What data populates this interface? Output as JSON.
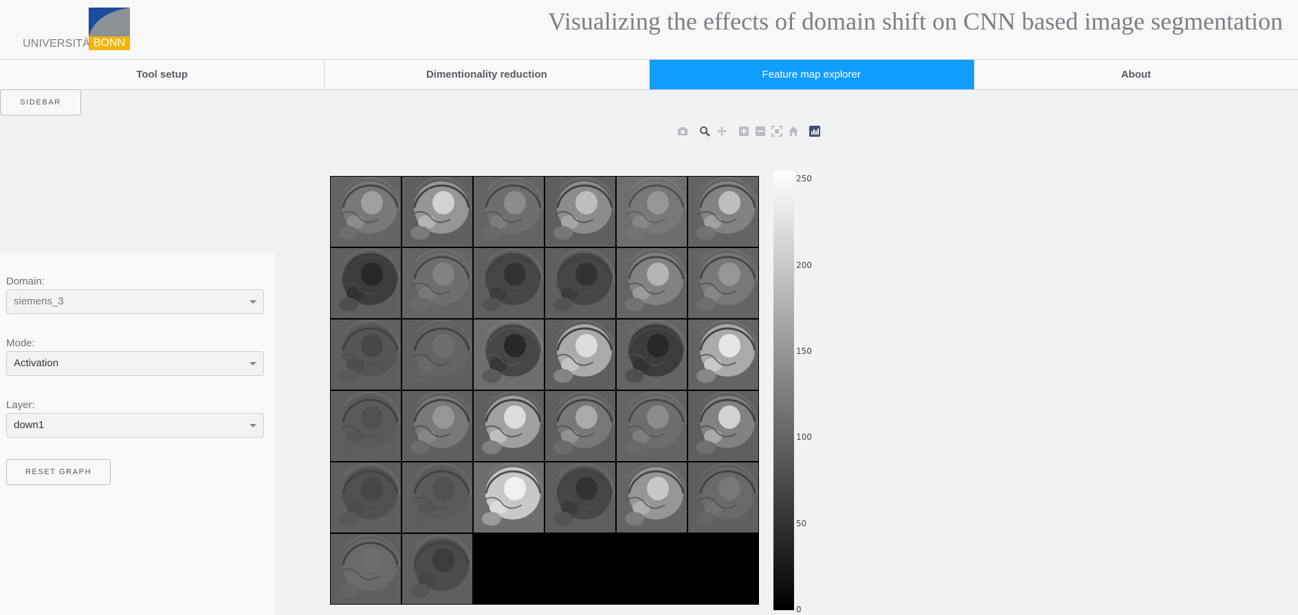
{
  "header": {
    "logo": {
      "university": "UNIVERSITÄT",
      "city": "BONN"
    },
    "title": "Visualizing the effects of domain shift on CNN based image segmentation"
  },
  "tabs": [
    {
      "label": "Tool setup",
      "active": false
    },
    {
      "label": "Dimentionality reduction",
      "active": false
    },
    {
      "label": "Feature map explorer",
      "active": true
    },
    {
      "label": "About",
      "active": false
    }
  ],
  "sidebar_toggle": {
    "label": "SIDEBAR"
  },
  "controls": {
    "domain": {
      "label": "Domain:",
      "value": "siemens_3",
      "disabled": true
    },
    "mode": {
      "label": "Mode:",
      "value": "Activation"
    },
    "layer": {
      "label": "Layer:",
      "value": "down1"
    },
    "reset": {
      "label": "RESET GRAPH"
    }
  },
  "modebar": {
    "icons": [
      "camera-icon",
      "zoom-icon",
      "pan-icon",
      "zoom-in-icon",
      "zoom-out-icon",
      "autoscale-icon",
      "home-icon",
      "plotly-logo-icon"
    ]
  },
  "feature_maps": {
    "grid": {
      "rows": 6,
      "cols": 6
    },
    "tiles": [
      {
        "mean": 100,
        "brain": 120,
        "bright": 160
      },
      {
        "mean": 95,
        "brain": 150,
        "bright": 210
      },
      {
        "mean": 100,
        "brain": 110,
        "bright": 140
      },
      {
        "mean": 95,
        "brain": 140,
        "bright": 190
      },
      {
        "mean": 110,
        "brain": 120,
        "bright": 150
      },
      {
        "mean": 100,
        "brain": 130,
        "bright": 190
      },
      {
        "mean": 95,
        "brain": 60,
        "bright": 40
      },
      {
        "mean": 100,
        "brain": 110,
        "bright": 130
      },
      {
        "mean": 95,
        "brain": 70,
        "bright": 50
      },
      {
        "mean": 95,
        "brain": 70,
        "bright": 50
      },
      {
        "mean": 100,
        "brain": 130,
        "bright": 180
      },
      {
        "mean": 100,
        "brain": 120,
        "bright": 150
      },
      {
        "mean": 95,
        "brain": 85,
        "bright": 70
      },
      {
        "mean": 95,
        "brain": 100,
        "bright": 110
      },
      {
        "mean": 110,
        "brain": 70,
        "bright": 40
      },
      {
        "mean": 95,
        "brain": 170,
        "bright": 220
      },
      {
        "mean": 100,
        "brain": 60,
        "bright": 40
      },
      {
        "mean": 100,
        "brain": 170,
        "bright": 230
      },
      {
        "mean": 95,
        "brain": 90,
        "bright": 80
      },
      {
        "mean": 95,
        "brain": 120,
        "bright": 150
      },
      {
        "mean": 95,
        "brain": 160,
        "bright": 220
      },
      {
        "mean": 95,
        "brain": 120,
        "bright": 170
      },
      {
        "mean": 100,
        "brain": 110,
        "bright": 140
      },
      {
        "mean": 95,
        "brain": 130,
        "bright": 210
      },
      {
        "mean": 95,
        "brain": 80,
        "bright": 70
      },
      {
        "mean": 95,
        "brain": 90,
        "bright": 80
      },
      {
        "mean": 110,
        "brain": 200,
        "bright": 240
      },
      {
        "mean": 95,
        "brain": 70,
        "bright": 50
      },
      {
        "mean": 100,
        "brain": 150,
        "bright": 200
      },
      {
        "mean": 95,
        "brain": 105,
        "bright": 120
      },
      {
        "mean": 95,
        "brain": 105,
        "bright": 110
      },
      {
        "mean": 95,
        "brain": 75,
        "bright": 60
      },
      null,
      null,
      null,
      null
    ],
    "colorscale": {
      "min": 0,
      "max": 255,
      "ticks": [
        "250",
        "200",
        "150",
        "100",
        "50",
        "0"
      ]
    }
  }
}
